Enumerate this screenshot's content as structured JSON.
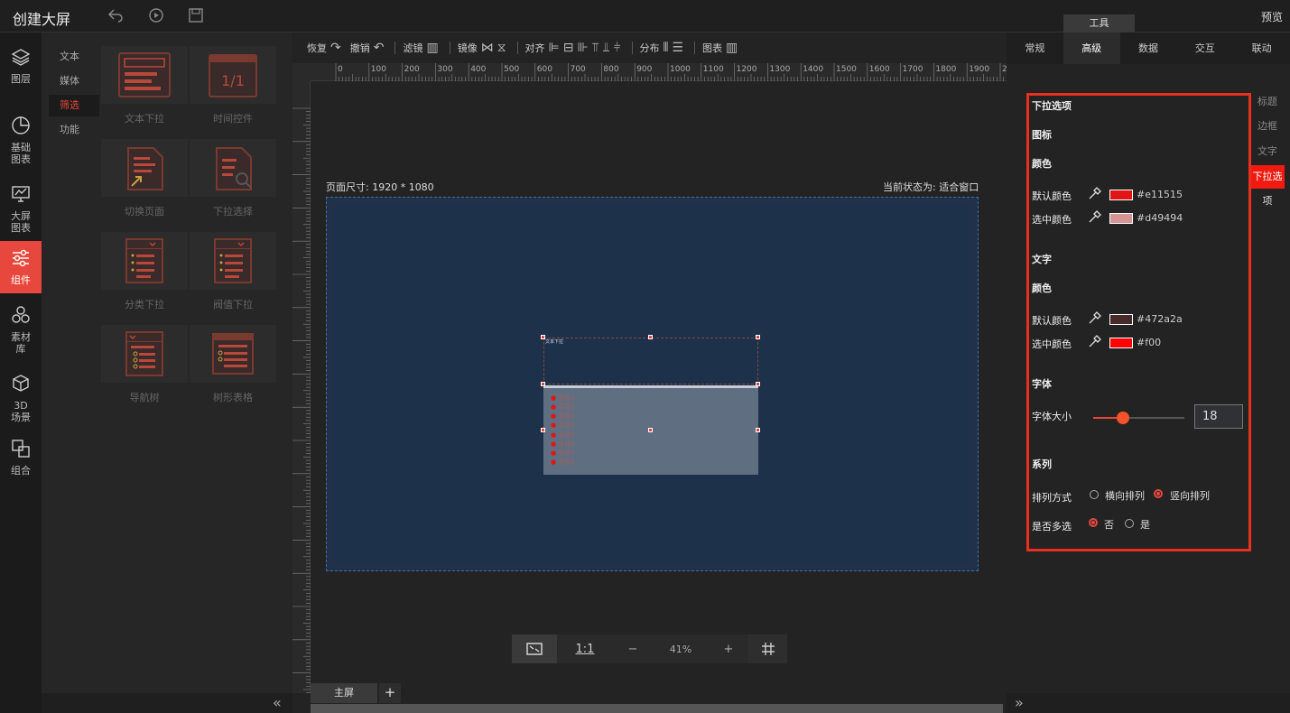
{
  "app": {
    "title": "创建大屏",
    "tools_tab": "工具",
    "preview_label": "预览"
  },
  "leftnav": [
    {
      "label": "图层",
      "icon": "layers-icon"
    },
    {
      "label": "基础\n图表",
      "icon": "pie-chart-icon"
    },
    {
      "label": "大屏\n图表",
      "icon": "screen-chart-icon"
    },
    {
      "label": "组件",
      "icon": "sliders-icon",
      "active": true
    },
    {
      "label": "素材\n库",
      "icon": "hexagons-icon"
    },
    {
      "label": "3D\n场景",
      "icon": "cube-icon"
    },
    {
      "label": "组合",
      "icon": "combine-icon"
    }
  ],
  "subnav": [
    {
      "label": "文本"
    },
    {
      "label": "媒体"
    },
    {
      "label": "筛选",
      "active": true
    },
    {
      "label": "功能"
    }
  ],
  "gallery": [
    {
      "label": "文本下拉",
      "icon": "text-dropdown-icon"
    },
    {
      "label": "时间控件",
      "icon": "calendar-icon",
      "thumb_text": "1/1"
    },
    {
      "label": "切换页面",
      "icon": "switch-page-icon"
    },
    {
      "label": "下拉选择",
      "icon": "dropdown-search-icon"
    },
    {
      "label": "分类下拉",
      "icon": "category-dropdown-icon"
    },
    {
      "label": "阀值下拉",
      "icon": "threshold-dropdown-icon"
    },
    {
      "label": "导航树",
      "icon": "nav-tree-icon"
    },
    {
      "label": "树形表格",
      "icon": "tree-table-icon"
    }
  ],
  "toolbar": {
    "redo": "恢复",
    "undo": "撤销",
    "filter": "滤镜",
    "mirror": "镜像",
    "align": "对齐",
    "distribute": "分布",
    "chart": "图表"
  },
  "ruler": {
    "marks": [
      "0",
      "100",
      "200",
      "300",
      "400",
      "500",
      "600",
      "700",
      "800",
      "900",
      "1000",
      "1100",
      "1200",
      "1300",
      "1400",
      "1500",
      "1600",
      "1700",
      "1800",
      "1900",
      "2000"
    ]
  },
  "canvas": {
    "page_size": "页面尺寸: 1920 * 1080",
    "current_state": "当前状态为: 适合窗口",
    "widget_title": "文本下拉",
    "dropdown_items": [
      "条目1",
      "条目2",
      "条目3",
      "条目4",
      "条目5",
      "条目6",
      "条目7",
      "条目8"
    ]
  },
  "zoom": {
    "fit_icon": "fit-screen-icon",
    "one_to_one": "1:1",
    "minus": "−",
    "value": "41%",
    "plus": "+",
    "grid_icon": "grid-icon"
  },
  "tabs": {
    "main": "主屏",
    "add": "+"
  },
  "rightpanel": {
    "tabs": [
      "常规",
      "高级",
      "数据",
      "交互",
      "联动"
    ],
    "active_tab": "高级",
    "side_tabs": [
      "标题",
      "边框",
      "文字",
      "下拉选",
      "项"
    ],
    "section_title": "下拉选项",
    "icon_label": "图标",
    "color_label": "颜色",
    "default_color_label": "默认颜色",
    "selected_color_label": "选中颜色",
    "icon_default_color": "#e11515",
    "icon_selected_color": "#d49494",
    "text_label": "文字",
    "text_color_label": "颜色",
    "text_default_color": "#472a2a",
    "text_selected_color": "#f00",
    "font_label": "字体",
    "font_size_label": "字体大小",
    "font_size_value": "18",
    "font_size_fraction": 0.33,
    "series_label": "系列",
    "arrange_label": "排列方式",
    "arrange_options": [
      "横向排列",
      "竖向排列"
    ],
    "arrange_selected": "竖向排列",
    "multi_label": "是否多选",
    "multi_options": [
      "否",
      "是"
    ],
    "multi_selected": "否"
  },
  "colors": {
    "accent": "#e8473d",
    "highlight_border": "#e8301f",
    "screen_bg": "#1e314a"
  }
}
